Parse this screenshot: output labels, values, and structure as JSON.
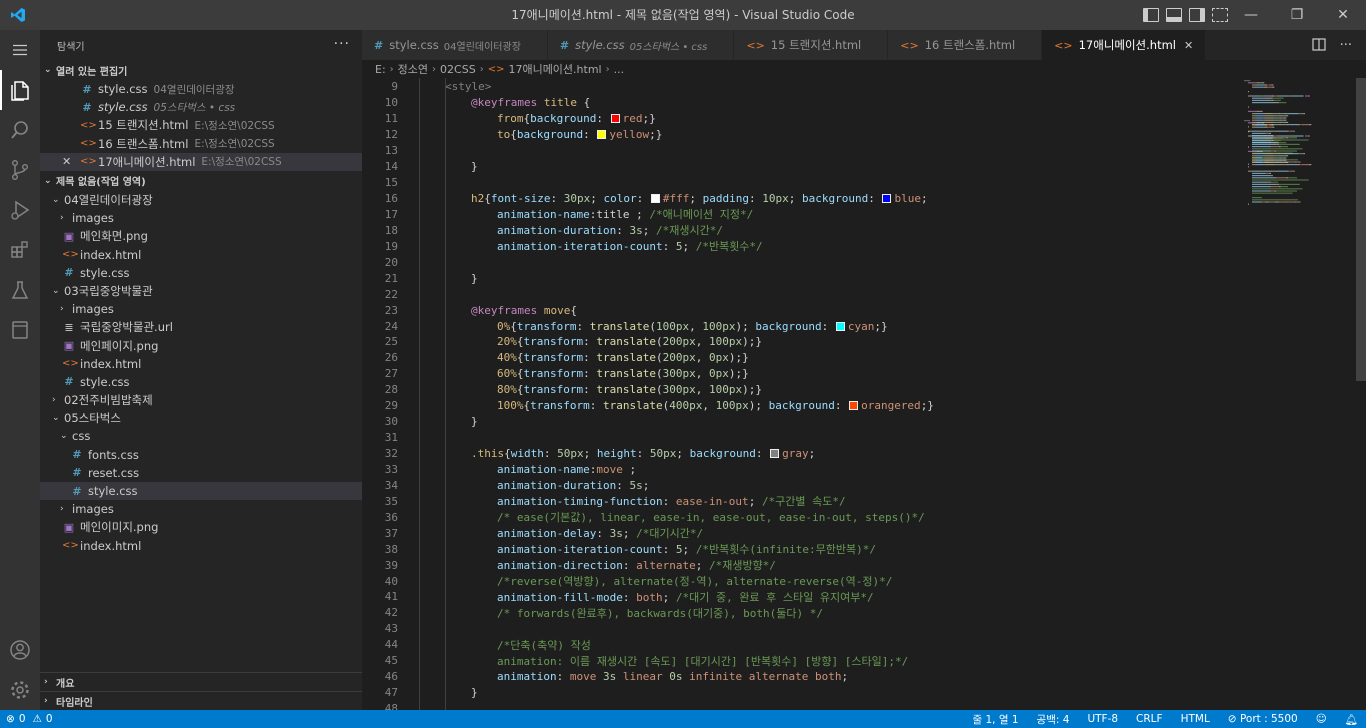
{
  "window": {
    "title": "17애니메이션.html - 제목 없음(작업 영역) - Visual Studio Code",
    "controls": [
      "—",
      "❐",
      "✕"
    ]
  },
  "sidebar": {
    "header": "탐색기",
    "open_editors_title": "열려 있는 편집기",
    "open_editors": [
      {
        "icon": "css",
        "name": "style.css",
        "desc": "04열린데이터광장",
        "italic": false
      },
      {
        "icon": "css",
        "name": "style.css",
        "desc": "05스타벅스 • css",
        "italic": true
      },
      {
        "icon": "html",
        "name": "15 트랜지션.html",
        "desc": "E:\\정소연\\02CSS",
        "italic": false
      },
      {
        "icon": "html",
        "name": "16 트랜스폼.html",
        "desc": "E:\\정소연\\02CSS",
        "italic": false
      },
      {
        "icon": "html",
        "name": "17애니메이션.html",
        "desc": "E:\\정소연\\02CSS",
        "italic": false,
        "selected": true
      }
    ],
    "workspace_title": "제목 없음(작업 영역)",
    "tree": [
      {
        "level": 1,
        "type": "folder-open",
        "name": "04열린데이터광장"
      },
      {
        "level": 2,
        "type": "folder",
        "name": "images"
      },
      {
        "level": 2,
        "type": "img",
        "name": "메인화면.png"
      },
      {
        "level": 2,
        "type": "html",
        "name": "index.html"
      },
      {
        "level": 2,
        "type": "css",
        "name": "style.css"
      },
      {
        "level": 1,
        "type": "folder-open",
        "name": "03국립중앙박물관"
      },
      {
        "level": 2,
        "type": "folder",
        "name": "images"
      },
      {
        "level": 2,
        "type": "url",
        "name": "국립중앙박물관.url"
      },
      {
        "level": 2,
        "type": "img",
        "name": "메인페이지.png"
      },
      {
        "level": 2,
        "type": "html",
        "name": "index.html"
      },
      {
        "level": 2,
        "type": "css",
        "name": "style.css"
      },
      {
        "level": 1,
        "type": "folder",
        "name": "02전주비빔밥축제"
      },
      {
        "level": 1,
        "type": "folder-open",
        "name": "05스타벅스"
      },
      {
        "level": 2,
        "type": "folder-open",
        "name": "css"
      },
      {
        "level": 3,
        "type": "css",
        "name": "fonts.css"
      },
      {
        "level": 3,
        "type": "css",
        "name": "reset.css"
      },
      {
        "level": 3,
        "type": "css",
        "name": "style.css",
        "selected": true
      },
      {
        "level": 2,
        "type": "folder",
        "name": "images"
      },
      {
        "level": 2,
        "type": "img",
        "name": "메인이미지.png"
      },
      {
        "level": 2,
        "type": "html",
        "name": "index.html"
      }
    ],
    "outline_title": "개요",
    "timeline_title": "타임라인"
  },
  "tabs": [
    {
      "icon": "css",
      "name": "style.css",
      "desc": "04열린데이터광장",
      "italic": false,
      "active": false
    },
    {
      "icon": "css",
      "name": "style.css",
      "desc": "05스타벅스 • css",
      "italic": true,
      "active": false
    },
    {
      "icon": "html",
      "name": "15 트랜지션.html",
      "desc": "",
      "italic": false,
      "active": false
    },
    {
      "icon": "html",
      "name": "16 트랜스폼.html",
      "desc": "",
      "italic": false,
      "active": false
    },
    {
      "icon": "html",
      "name": "17애니메이션.html",
      "desc": "",
      "italic": false,
      "active": true
    }
  ],
  "breadcrumb": [
    "E:",
    "정소연",
    "02CSS",
    "17애니메이션.html",
    "..."
  ],
  "code_lines": [
    {
      "n": 9,
      "indent": 0,
      "tokens": [
        [
          "tag",
          "<style>"
        ]
      ]
    },
    {
      "n": 10,
      "indent": 1,
      "tokens": [
        [
          "at",
          "@keyframes"
        ],
        [
          "plain",
          " "
        ],
        [
          "sel",
          "title"
        ],
        [
          "plain",
          " {"
        ]
      ]
    },
    {
      "n": 11,
      "indent": 2,
      "tokens": [
        [
          "sel",
          "from"
        ],
        [
          "plain",
          "{"
        ],
        [
          "prop",
          "background"
        ],
        [
          "plain",
          ": "
        ],
        [
          "swatch",
          "#ff0000"
        ],
        [
          "val",
          "red"
        ],
        [
          "plain",
          ";}"
        ]
      ]
    },
    {
      "n": 12,
      "indent": 2,
      "tokens": [
        [
          "sel",
          "to"
        ],
        [
          "plain",
          "{"
        ],
        [
          "prop",
          "background"
        ],
        [
          "plain",
          ": "
        ],
        [
          "swatch",
          "#ffff00"
        ],
        [
          "val",
          "yellow"
        ],
        [
          "plain",
          ";}"
        ]
      ]
    },
    {
      "n": 13,
      "indent": 0,
      "tokens": []
    },
    {
      "n": 14,
      "indent": 1,
      "tokens": [
        [
          "plain",
          "}"
        ]
      ]
    },
    {
      "n": 15,
      "indent": 0,
      "tokens": []
    },
    {
      "n": 16,
      "indent": 1,
      "tokens": [
        [
          "sel",
          "h2"
        ],
        [
          "plain",
          "{"
        ],
        [
          "prop",
          "font-size"
        ],
        [
          "plain",
          ": "
        ],
        [
          "num",
          "30px"
        ],
        [
          "plain",
          "; "
        ],
        [
          "prop",
          "color"
        ],
        [
          "plain",
          ": "
        ],
        [
          "swatch",
          "#ffffff"
        ],
        [
          "val",
          "#fff"
        ],
        [
          "plain",
          "; "
        ],
        [
          "prop",
          "padding"
        ],
        [
          "plain",
          ": "
        ],
        [
          "num",
          "10px"
        ],
        [
          "plain",
          "; "
        ],
        [
          "prop",
          "background"
        ],
        [
          "plain",
          ": "
        ],
        [
          "swatch",
          "#0000ff"
        ],
        [
          "val",
          "blue"
        ],
        [
          "plain",
          ";"
        ]
      ]
    },
    {
      "n": 17,
      "indent": 2,
      "tokens": [
        [
          "prop",
          "animation-name"
        ],
        [
          "plain",
          ":title ; "
        ],
        [
          "com",
          "/*애니메이션 지정*/"
        ]
      ]
    },
    {
      "n": 18,
      "indent": 2,
      "tokens": [
        [
          "prop",
          "animation-duration"
        ],
        [
          "plain",
          ": "
        ],
        [
          "num",
          "3s"
        ],
        [
          "plain",
          "; "
        ],
        [
          "com",
          "/*재생시간*/"
        ]
      ]
    },
    {
      "n": 19,
      "indent": 2,
      "tokens": [
        [
          "prop",
          "animation-iteration-count"
        ],
        [
          "plain",
          ": "
        ],
        [
          "num",
          "5"
        ],
        [
          "plain",
          "; "
        ],
        [
          "com",
          "/*반복횟수*/"
        ]
      ]
    },
    {
      "n": 20,
      "indent": 0,
      "tokens": []
    },
    {
      "n": 21,
      "indent": 1,
      "tokens": [
        [
          "plain",
          "}"
        ]
      ]
    },
    {
      "n": 22,
      "indent": 0,
      "tokens": []
    },
    {
      "n": 23,
      "indent": 1,
      "tokens": [
        [
          "at",
          "@keyframes"
        ],
        [
          "plain",
          " "
        ],
        [
          "sel",
          "move"
        ],
        [
          "plain",
          "{"
        ]
      ]
    },
    {
      "n": 24,
      "indent": 2,
      "tokens": [
        [
          "sel",
          "0%"
        ],
        [
          "plain",
          "{"
        ],
        [
          "prop",
          "transform"
        ],
        [
          "plain",
          ": "
        ],
        [
          "fn",
          "translate"
        ],
        [
          "plain",
          "("
        ],
        [
          "num",
          "100px"
        ],
        [
          "plain",
          ", "
        ],
        [
          "num",
          "100px"
        ],
        [
          "plain",
          "); "
        ],
        [
          "prop",
          "background"
        ],
        [
          "plain",
          ": "
        ],
        [
          "swatch",
          "#00ffff"
        ],
        [
          "val",
          "cyan"
        ],
        [
          "plain",
          ";}"
        ]
      ]
    },
    {
      "n": 25,
      "indent": 2,
      "tokens": [
        [
          "sel",
          "20%"
        ],
        [
          "plain",
          "{"
        ],
        [
          "prop",
          "transform"
        ],
        [
          "plain",
          ": "
        ],
        [
          "fn",
          "translate"
        ],
        [
          "plain",
          "("
        ],
        [
          "num",
          "200px"
        ],
        [
          "plain",
          ", "
        ],
        [
          "num",
          "100px"
        ],
        [
          "plain",
          ");}"
        ]
      ]
    },
    {
      "n": 26,
      "indent": 2,
      "tokens": [
        [
          "sel",
          "40%"
        ],
        [
          "plain",
          "{"
        ],
        [
          "prop",
          "transform"
        ],
        [
          "plain",
          ": "
        ],
        [
          "fn",
          "translate"
        ],
        [
          "plain",
          "("
        ],
        [
          "num",
          "200px"
        ],
        [
          "plain",
          ", "
        ],
        [
          "num",
          "0px"
        ],
        [
          "plain",
          ");}"
        ]
      ]
    },
    {
      "n": 27,
      "indent": 2,
      "tokens": [
        [
          "sel",
          "60%"
        ],
        [
          "plain",
          "{"
        ],
        [
          "prop",
          "transform"
        ],
        [
          "plain",
          ": "
        ],
        [
          "fn",
          "translate"
        ],
        [
          "plain",
          "("
        ],
        [
          "num",
          "300px"
        ],
        [
          "plain",
          ", "
        ],
        [
          "num",
          "0px"
        ],
        [
          "plain",
          ");}"
        ]
      ]
    },
    {
      "n": 28,
      "indent": 2,
      "tokens": [
        [
          "sel",
          "80%"
        ],
        [
          "plain",
          "{"
        ],
        [
          "prop",
          "transform"
        ],
        [
          "plain",
          ": "
        ],
        [
          "fn",
          "translate"
        ],
        [
          "plain",
          "("
        ],
        [
          "num",
          "300px"
        ],
        [
          "plain",
          ", "
        ],
        [
          "num",
          "100px"
        ],
        [
          "plain",
          ");}"
        ]
      ]
    },
    {
      "n": 29,
      "indent": 2,
      "tokens": [
        [
          "sel",
          "100%"
        ],
        [
          "plain",
          "{"
        ],
        [
          "prop",
          "transform"
        ],
        [
          "plain",
          ": "
        ],
        [
          "fn",
          "translate"
        ],
        [
          "plain",
          "("
        ],
        [
          "num",
          "400px"
        ],
        [
          "plain",
          ", "
        ],
        [
          "num",
          "100px"
        ],
        [
          "plain",
          "); "
        ],
        [
          "prop",
          "background"
        ],
        [
          "plain",
          ": "
        ],
        [
          "swatch",
          "#ff4500"
        ],
        [
          "val",
          "orangered"
        ],
        [
          "plain",
          ";}"
        ]
      ]
    },
    {
      "n": 30,
      "indent": 1,
      "tokens": [
        [
          "plain",
          "}"
        ]
      ]
    },
    {
      "n": 31,
      "indent": 0,
      "tokens": []
    },
    {
      "n": 32,
      "indent": 1,
      "tokens": [
        [
          "sel",
          ".this"
        ],
        [
          "plain",
          "{"
        ],
        [
          "prop",
          "width"
        ],
        [
          "plain",
          ": "
        ],
        [
          "num",
          "50px"
        ],
        [
          "plain",
          "; "
        ],
        [
          "prop",
          "height"
        ],
        [
          "plain",
          ": "
        ],
        [
          "num",
          "50px"
        ],
        [
          "plain",
          "; "
        ],
        [
          "prop",
          "background"
        ],
        [
          "plain",
          ": "
        ],
        [
          "swatch",
          "#808080"
        ],
        [
          "val",
          "gray"
        ],
        [
          "plain",
          ";"
        ]
      ]
    },
    {
      "n": 33,
      "indent": 2,
      "tokens": [
        [
          "prop",
          "animation-name"
        ],
        [
          "plain",
          ":"
        ],
        [
          "val",
          "move"
        ],
        [
          "plain",
          " ;"
        ]
      ]
    },
    {
      "n": 34,
      "indent": 2,
      "tokens": [
        [
          "prop",
          "animation-duration"
        ],
        [
          "plain",
          ": "
        ],
        [
          "num",
          "5s"
        ],
        [
          "plain",
          ";"
        ]
      ]
    },
    {
      "n": 35,
      "indent": 2,
      "tokens": [
        [
          "prop",
          "animation-timing-function"
        ],
        [
          "plain",
          ": "
        ],
        [
          "val",
          "ease-in-out"
        ],
        [
          "plain",
          "; "
        ],
        [
          "com",
          "/*구간별 속도*/"
        ]
      ]
    },
    {
      "n": 36,
      "indent": 2,
      "tokens": [
        [
          "com",
          "/* ease(기본값), linear, ease-in, ease-out, ease-in-out, steps()*/"
        ]
      ]
    },
    {
      "n": 37,
      "indent": 2,
      "tokens": [
        [
          "prop",
          "animation-delay"
        ],
        [
          "plain",
          ": "
        ],
        [
          "num",
          "3s"
        ],
        [
          "plain",
          "; "
        ],
        [
          "com",
          "/*대기시간*/"
        ]
      ]
    },
    {
      "n": 38,
      "indent": 2,
      "tokens": [
        [
          "prop",
          "animation-iteration-count"
        ],
        [
          "plain",
          ": "
        ],
        [
          "num",
          "5"
        ],
        [
          "plain",
          "; "
        ],
        [
          "com",
          "/*반복횟수(infinite:무한반복)*/"
        ]
      ]
    },
    {
      "n": 39,
      "indent": 2,
      "tokens": [
        [
          "prop",
          "animation-direction"
        ],
        [
          "plain",
          ": "
        ],
        [
          "val",
          "alternate"
        ],
        [
          "plain",
          "; "
        ],
        [
          "com",
          "/*재생방향*/"
        ]
      ]
    },
    {
      "n": 40,
      "indent": 2,
      "tokens": [
        [
          "com",
          "/*reverse(역방향), alternate(정-역), alternate-reverse(역-정)*/"
        ]
      ]
    },
    {
      "n": 41,
      "indent": 2,
      "tokens": [
        [
          "prop",
          "animation-fill-mode"
        ],
        [
          "plain",
          ": "
        ],
        [
          "val",
          "both"
        ],
        [
          "plain",
          "; "
        ],
        [
          "com",
          "/*대기 중, 완료 후 스타일 유지여부*/"
        ]
      ]
    },
    {
      "n": 42,
      "indent": 2,
      "tokens": [
        [
          "com",
          "/* forwards(완료후), backwards(대기중), both(둘다) */"
        ]
      ]
    },
    {
      "n": 43,
      "indent": 0,
      "tokens": []
    },
    {
      "n": 44,
      "indent": 2,
      "tokens": [
        [
          "com",
          "/*단축(축약) 작성"
        ]
      ]
    },
    {
      "n": 45,
      "indent": 2,
      "tokens": [
        [
          "com",
          "animation: 이름 재생시간 [속도] [대기시간] [반복횟수] [방향] [스타일];*/"
        ]
      ]
    },
    {
      "n": 46,
      "indent": 2,
      "tokens": [
        [
          "prop",
          "animation"
        ],
        [
          "plain",
          ": "
        ],
        [
          "val",
          "move"
        ],
        [
          "plain",
          " "
        ],
        [
          "num",
          "3s"
        ],
        [
          "plain",
          " "
        ],
        [
          "val",
          "linear"
        ],
        [
          "plain",
          " "
        ],
        [
          "num",
          "0s"
        ],
        [
          "plain",
          " "
        ],
        [
          "val",
          "infinite"
        ],
        [
          "plain",
          " "
        ],
        [
          "val",
          "alternate"
        ],
        [
          "plain",
          " "
        ],
        [
          "val",
          "both"
        ],
        [
          "plain",
          ";"
        ]
      ]
    },
    {
      "n": 47,
      "indent": 1,
      "tokens": [
        [
          "plain",
          "}"
        ]
      ]
    },
    {
      "n": 48,
      "indent": 0,
      "tokens": []
    }
  ],
  "status": {
    "errors": "0",
    "warnings": "0",
    "position": "줄 1, 열 1",
    "spaces": "공백: 4",
    "encoding": "UTF-8",
    "eol": "CRLF",
    "language": "HTML",
    "port": "Port : 5500"
  },
  "colors": {
    "tag": "#808080",
    "at": "#c586c0",
    "sel": "#d7ba7d",
    "prop": "#9cdcfe",
    "val": "#ce9178",
    "num": "#b5cea8",
    "fn": "#dcdcaa",
    "com": "#6a9955",
    "plain": "#d4d4d4",
    "statusbar": "#007acc"
  }
}
